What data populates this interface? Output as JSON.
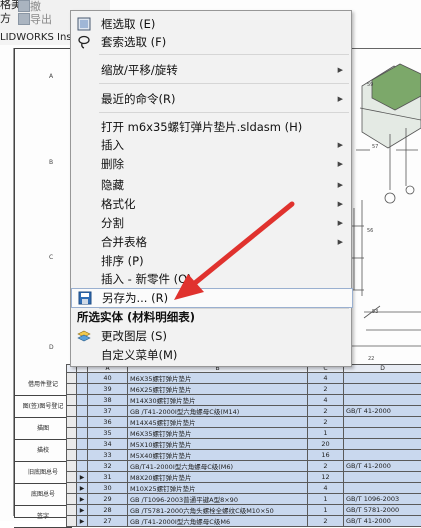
{
  "toolbar": {
    "line1": "格美",
    "line2": "方",
    "undo_label": "撤",
    "export_label": "导出"
  },
  "app_tab": {
    "label": "LIDWORKS Ins"
  },
  "context_menu": {
    "items": [
      {
        "label": "框选取 (E)",
        "submenu": false
      },
      {
        "label": "套索选取 (F)",
        "submenu": false
      },
      {
        "label": "缩放/平移/旋转",
        "submenu": true
      },
      {
        "label": "最近的命令(R)",
        "submenu": true
      },
      {
        "label": "打开 m6x35螺钉弹片垫片.sldasm (H)",
        "submenu": false
      },
      {
        "label": "插入",
        "submenu": true
      },
      {
        "label": "删除",
        "submenu": true
      },
      {
        "label": "隐藏",
        "submenu": true
      },
      {
        "label": "格式化",
        "submenu": true
      },
      {
        "label": "分割",
        "submenu": true
      },
      {
        "label": "合并表格",
        "submenu": true
      },
      {
        "label": "排序 (P)",
        "submenu": false
      },
      {
        "label": "插入 - 新零件 (Q)",
        "submenu": false
      },
      {
        "label": "另存为... (R)",
        "submenu": false
      },
      {
        "label": "所选实体 (材料明细表)",
        "submenu": false
      },
      {
        "label": "更改图层 (S)",
        "submenu": false
      },
      {
        "label": "自定义菜单(M)",
        "submenu": false
      }
    ],
    "submenu_glyph": "▶"
  },
  "drawing": {
    "zones": [
      "A",
      "B",
      "C",
      "D"
    ],
    "ref_labels": [
      "59",
      "57",
      "56",
      "53",
      "22"
    ],
    "left_cells": [
      "借用件登记",
      "图(签)图号登记",
      "描图",
      "描校",
      "旧底图总号",
      "底图总号",
      "签字"
    ]
  },
  "bom": {
    "col_headers": [
      "A",
      "B",
      "C",
      "D"
    ],
    "rows": [
      {
        "arrow": "",
        "no": "40",
        "desc": "M6X35螺钉弹片垫片",
        "qty": "4",
        "code": ""
      },
      {
        "arrow": "",
        "no": "39",
        "desc": "M6X25螺钉弹片垫片",
        "qty": "2",
        "code": ""
      },
      {
        "arrow": "",
        "no": "38",
        "desc": "M14X30螺钉弹片垫片",
        "qty": "4",
        "code": ""
      },
      {
        "arrow": "",
        "no": "37",
        "desc": "GB /T41-2000I型六角螺母C级(M14)",
        "qty": "2",
        "code": "GB/T 41-2000"
      },
      {
        "arrow": "",
        "no": "36",
        "desc": "M14X45螺钉弹片垫片",
        "qty": "2",
        "code": ""
      },
      {
        "arrow": "",
        "no": "35",
        "desc": "M6X35螺钉弹片垫片",
        "qty": "1",
        "code": ""
      },
      {
        "arrow": "",
        "no": "34",
        "desc": "M5X10螺钉弹片垫片",
        "qty": "20",
        "code": ""
      },
      {
        "arrow": "",
        "no": "33",
        "desc": "M5X40螺钉弹片垫片",
        "qty": "16",
        "code": ""
      },
      {
        "arrow": "",
        "no": "32",
        "desc": "GB/T41-2000I型六角螺母C级(M6)",
        "qty": "2",
        "code": "GB/T 41-2000"
      },
      {
        "arrow": "▶",
        "no": "31",
        "desc": "M8X20螺钉弹片垫片",
        "qty": "12",
        "code": ""
      },
      {
        "arrow": "▶",
        "no": "30",
        "desc": "M10X25螺钉弹片垫片",
        "qty": "4",
        "code": ""
      },
      {
        "arrow": "▶",
        "no": "29",
        "desc": "GB /T1096-2003普通平键A型8×90",
        "qty": "1",
        "code": "GB/T 1096-2003"
      },
      {
        "arrow": "▶",
        "no": "28",
        "desc": "GB /T5781-2000六角头螺栓全螺纹C级M10×50",
        "qty": "1",
        "code": "GB/T 5781-2000"
      },
      {
        "arrow": "▶",
        "no": "27",
        "desc": "GB /T41-2000I型六角螺母C级M6",
        "qty": "2",
        "code": "GB/T 41-2000"
      }
    ]
  }
}
